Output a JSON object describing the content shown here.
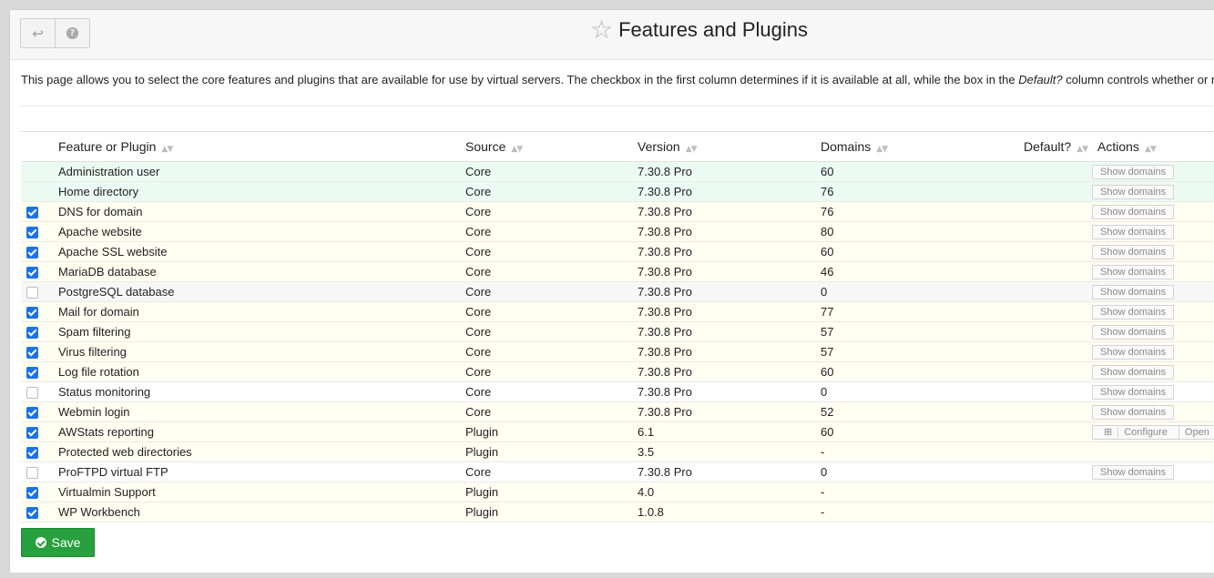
{
  "header": {
    "title": "Features and Plugins",
    "back_icon": "↩",
    "help_icon": "?",
    "star_icon": "☆"
  },
  "description": {
    "before": "This page allows you to select the core features and plugins that are available for use by virtual servers. The checkbox in the first column determines if it is available at all, while the box in the ",
    "em": "Default?",
    "after": " column controls whether or n"
  },
  "table": {
    "columns": {
      "name": "Feature or Plugin",
      "source": "Source",
      "version": "Version",
      "domains": "Domains",
      "default": "Default?",
      "actions": "Actions"
    },
    "rows": [
      {
        "enabled": null,
        "name": "Administration user",
        "source": "Core",
        "version": "7.30.8 Pro",
        "domains": "60",
        "default": true,
        "default_disabled": false,
        "action": "show",
        "bg": "g"
      },
      {
        "enabled": null,
        "name": "Home directory",
        "source": "Core",
        "version": "7.30.8 Pro",
        "domains": "76",
        "default": true,
        "default_disabled": false,
        "action": "show",
        "bg": "g"
      },
      {
        "enabled": true,
        "name": "DNS for domain",
        "source": "Core",
        "version": "7.30.8 Pro",
        "domains": "76",
        "default": true,
        "default_disabled": false,
        "action": "show",
        "bg": "y"
      },
      {
        "enabled": true,
        "name": "Apache website",
        "source": "Core",
        "version": "7.30.8 Pro",
        "domains": "80",
        "default": true,
        "default_disabled": false,
        "action": "show",
        "bg": "y"
      },
      {
        "enabled": true,
        "name": "Apache SSL website",
        "source": "Core",
        "version": "7.30.8 Pro",
        "domains": "60",
        "default": false,
        "default_disabled": false,
        "action": "show",
        "bg": "y"
      },
      {
        "enabled": true,
        "name": "MariaDB database",
        "source": "Core",
        "version": "7.30.8 Pro",
        "domains": "46",
        "default": true,
        "default_disabled": false,
        "action": "show",
        "bg": "y"
      },
      {
        "enabled": false,
        "name": "PostgreSQL database",
        "source": "Core",
        "version": "7.30.8 Pro",
        "domains": "0",
        "default": true,
        "default_disabled": true,
        "action": "show",
        "bg": "l"
      },
      {
        "enabled": true,
        "name": "Mail for domain",
        "source": "Core",
        "version": "7.30.8 Pro",
        "domains": "77",
        "default": true,
        "default_disabled": false,
        "action": "show",
        "bg": "y"
      },
      {
        "enabled": true,
        "name": "Spam filtering",
        "source": "Core",
        "version": "7.30.8 Pro",
        "domains": "57",
        "default": true,
        "default_disabled": false,
        "action": "show",
        "bg": "y"
      },
      {
        "enabled": true,
        "name": "Virus filtering",
        "source": "Core",
        "version": "7.30.8 Pro",
        "domains": "57",
        "default": true,
        "default_disabled": false,
        "action": "show",
        "bg": "y"
      },
      {
        "enabled": true,
        "name": "Log file rotation",
        "source": "Core",
        "version": "7.30.8 Pro",
        "domains": "60",
        "default": true,
        "default_disabled": false,
        "action": "show",
        "bg": "y"
      },
      {
        "enabled": false,
        "name": "Status monitoring",
        "source": "Core",
        "version": "7.30.8 Pro",
        "domains": "0",
        "default": true,
        "default_disabled": true,
        "action": "show",
        "bg": "w"
      },
      {
        "enabled": true,
        "name": "Webmin login",
        "source": "Core",
        "version": "7.30.8 Pro",
        "domains": "52",
        "default": true,
        "default_disabled": false,
        "action": "show",
        "bg": "y"
      },
      {
        "enabled": true,
        "name": "AWStats reporting",
        "source": "Plugin",
        "version": "6.1",
        "domains": "60",
        "default": true,
        "default_disabled": false,
        "action": "configure",
        "bg": "y"
      },
      {
        "enabled": true,
        "name": "Protected web directories",
        "source": "Plugin",
        "version": "3.5",
        "domains": "-",
        "default": true,
        "default_disabled": false,
        "action": "none",
        "bg": "y"
      },
      {
        "enabled": false,
        "name": "ProFTPD virtual FTP",
        "source": "Core",
        "version": "7.30.8 Pro",
        "domains": "0",
        "default": true,
        "default_disabled": true,
        "action": "show",
        "bg": "w"
      },
      {
        "enabled": true,
        "name": "Virtualmin Support",
        "source": "Plugin",
        "version": "4.0",
        "domains": "-",
        "default": true,
        "default_disabled": false,
        "action": "none",
        "bg": "y"
      },
      {
        "enabled": true,
        "name": "WP Workbench",
        "source": "Plugin",
        "version": "1.0.8",
        "domains": "-",
        "default": true,
        "default_disabled": false,
        "action": "none",
        "bg": "y"
      }
    ],
    "actions": {
      "show_domains": "Show domains",
      "configure": "Configure",
      "configure_icon": "⊞",
      "open": "Open"
    }
  },
  "save_label": "Save",
  "colors": {
    "primary_checkbox": "#1a73e8",
    "save_button": "#27a03d",
    "row_core_bg": "#ecfbf1",
    "row_enabled_bg": "#fefef1"
  }
}
